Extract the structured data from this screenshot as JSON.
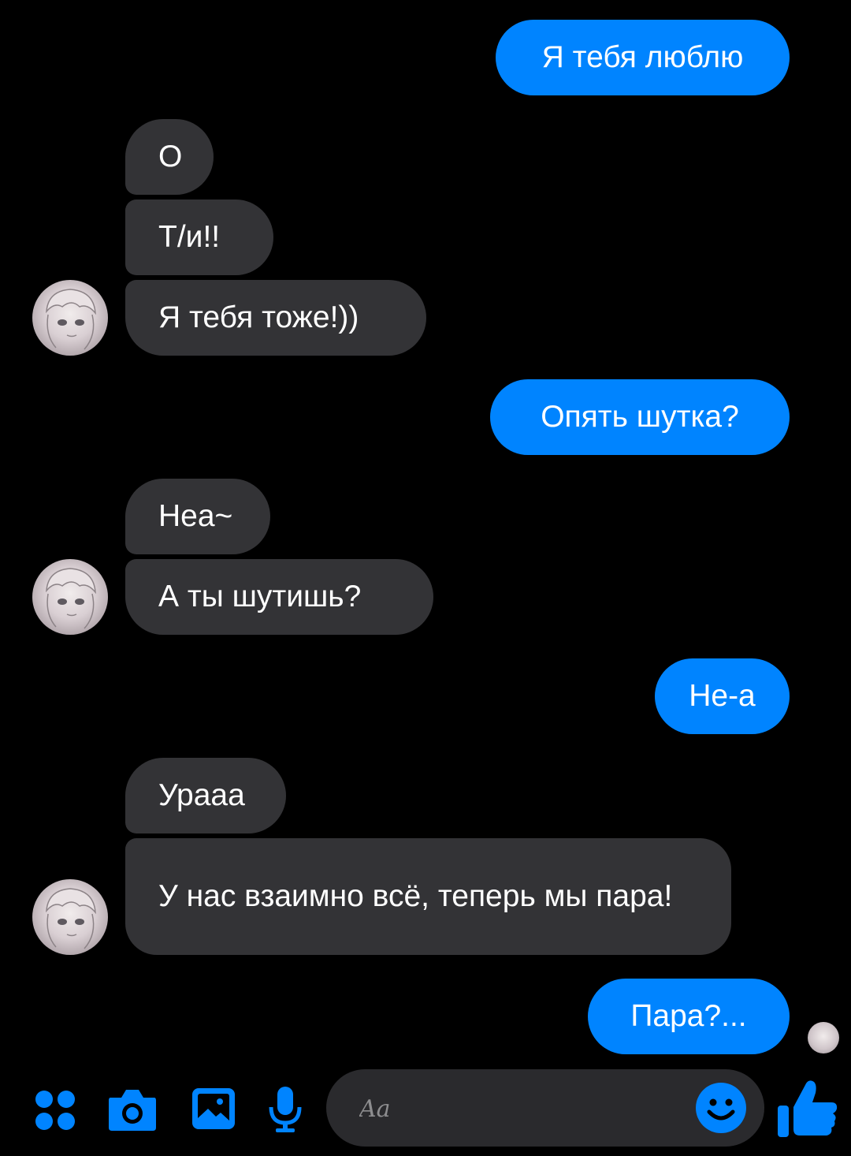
{
  "messages": [
    {
      "side": "out",
      "text": "Я тебя люблю"
    },
    {
      "side": "in",
      "text": "О"
    },
    {
      "side": "in",
      "text": "Т/и!!"
    },
    {
      "side": "in",
      "text": "Я тебя тоже!))"
    },
    {
      "side": "out",
      "text": "Опять шутка?"
    },
    {
      "side": "in",
      "text": "Неа~"
    },
    {
      "side": "in",
      "text": "А ты шутишь?"
    },
    {
      "side": "out",
      "text": "Не-а"
    },
    {
      "side": "in",
      "text": "Урааа"
    },
    {
      "side": "in",
      "text": "У нас взаимно всё, теперь мы пара!"
    },
    {
      "side": "out",
      "text": "Пара?..."
    }
  ],
  "composer": {
    "placeholder": "Aa"
  },
  "toolbar": {
    "icons": [
      "apps-grid-icon",
      "camera-icon",
      "gallery-icon",
      "microphone-icon",
      "emoji-icon",
      "thumbs-up-icon"
    ]
  },
  "colors": {
    "accent": "#0084ff",
    "incoming_bubble": "#333336",
    "background": "#000000",
    "composer": "#2a2a2d"
  }
}
